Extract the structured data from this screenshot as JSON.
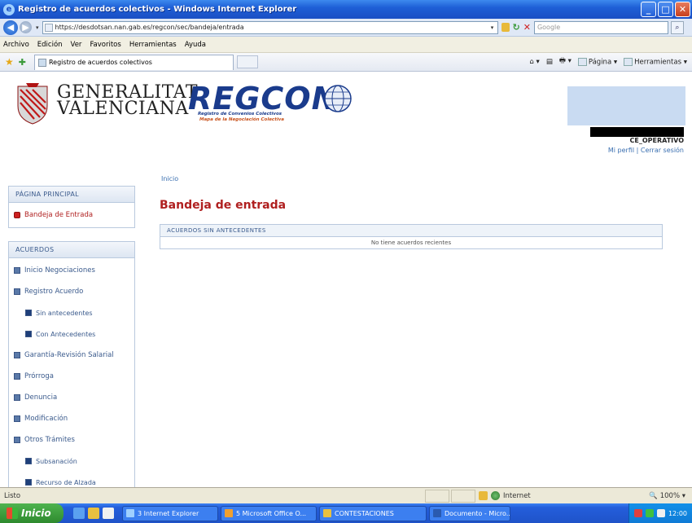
{
  "window": {
    "title": "Registro de acuerdos colectivos - Windows Internet Explorer",
    "controls": [
      "_",
      "□",
      "✕"
    ]
  },
  "addressbar": {
    "url": "https://desdotsan.nan.gab.es/regcon/sec/bandeja/entrada",
    "search_placeholder": "Google"
  },
  "menu": [
    "Archivo",
    "Edición",
    "Ver",
    "Favoritos",
    "Herramientas",
    "Ayuda"
  ],
  "tabs": {
    "active_label": "Registro de acuerdos colectivos"
  },
  "commandbar": {
    "page_label": "Página",
    "tools_label": "Herramientas"
  },
  "header": {
    "gv_line1": "GENERALITAT",
    "gv_line2": "VALENCIANA",
    "logo_title": "REGCON",
    "logo_sub1": "Registro de Convenios Colectivos",
    "logo_sub2": "Mapa de la Negociación Colectiva",
    "role": "CE_OPERATIVO",
    "link_profile": "Mi perfil",
    "link_sep": "|",
    "link_logout": "Cerrar sesión"
  },
  "breadcrumb": "Inicio",
  "sidebar": {
    "main_section": {
      "title": "PÁGINA PRINCIPAL",
      "items": [
        {
          "label": "Bandeja de Entrada"
        }
      ]
    },
    "acuerdos_section": {
      "title": "ACUERDOS",
      "items": [
        {
          "label": "Inicio Negociaciones",
          "level": 1
        },
        {
          "label": "Registro Acuerdo",
          "level": 1
        },
        {
          "label": "Sin antecedentes",
          "level": 2
        },
        {
          "label": "Con Antecedentes",
          "level": 2
        },
        {
          "label": "Garantía-Revisión Salarial",
          "level": 1
        },
        {
          "label": "Prórroga",
          "level": 1
        },
        {
          "label": "Denuncia",
          "level": 1
        },
        {
          "label": "Modificación",
          "level": 1
        },
        {
          "label": "Otros Trámites",
          "level": 1
        },
        {
          "label": "Subsanación",
          "level": 2
        },
        {
          "label": "Recurso de Alzada",
          "level": 2
        }
      ]
    }
  },
  "main": {
    "title": "Bandeja de entrada",
    "panel_header": "ACUERDOS SIN ANTECEDENTES",
    "panel_message": "No tiene acuerdos recientes"
  },
  "statusbar": {
    "status": "Listo",
    "zone": "Internet",
    "zoom": "100%"
  },
  "taskbar": {
    "start_label": "Inicio",
    "tasks": [
      "3 Internet Explorer",
      "5 Microsoft Office O...",
      "CONTESTACIONES",
      "Documento - Micro..."
    ],
    "clock": "12:00"
  },
  "colors": {
    "accent_red": "#b02020",
    "link_blue": "#3a6fb0",
    "regcon_blue": "#1a3b8c"
  }
}
